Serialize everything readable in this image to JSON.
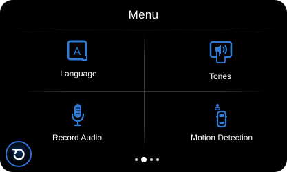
{
  "header": {
    "title": "Menu"
  },
  "tiles": [
    {
      "id": "language",
      "label": "Language",
      "icon": "language-icon"
    },
    {
      "id": "tones",
      "label": "Tones",
      "icon": "tones-icon"
    },
    {
      "id": "record_audio",
      "label": "Record Audio",
      "icon": "microphone-icon"
    },
    {
      "id": "motion_detection",
      "label": "Motion Detection",
      "icon": "motion-detection-icon"
    }
  ],
  "back_button": {
    "icon": "back-arrow-icon"
  },
  "pager": {
    "page_count": 4,
    "current_page": 2
  },
  "colors": {
    "background": "#000000",
    "accent": "#2f7bd8",
    "text": "#ffffff",
    "divider": "#3a3a3a"
  }
}
